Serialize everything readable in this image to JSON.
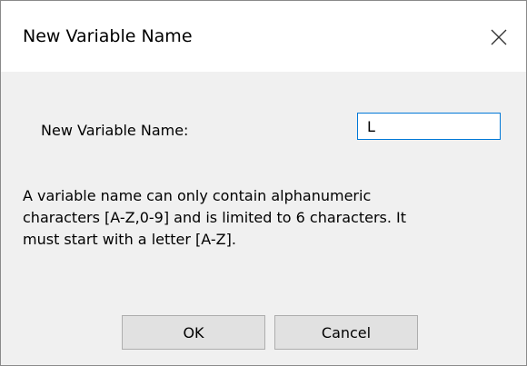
{
  "window": {
    "title": "New Variable Name",
    "close_icon": "close-icon"
  },
  "form": {
    "label": "New Variable Name:",
    "value": "L"
  },
  "help_text": "A variable name can only contain alphanumeric\ncharacters [A-Z,0-9] and is limited to 6 characters.  It\nmust start with a letter [A-Z].",
  "buttons": {
    "ok": "OK",
    "cancel": "Cancel"
  },
  "colors": {
    "input_focus_border": "#0078d7",
    "dialog_background": "#f0f0f0",
    "button_background": "#e1e1e1"
  }
}
